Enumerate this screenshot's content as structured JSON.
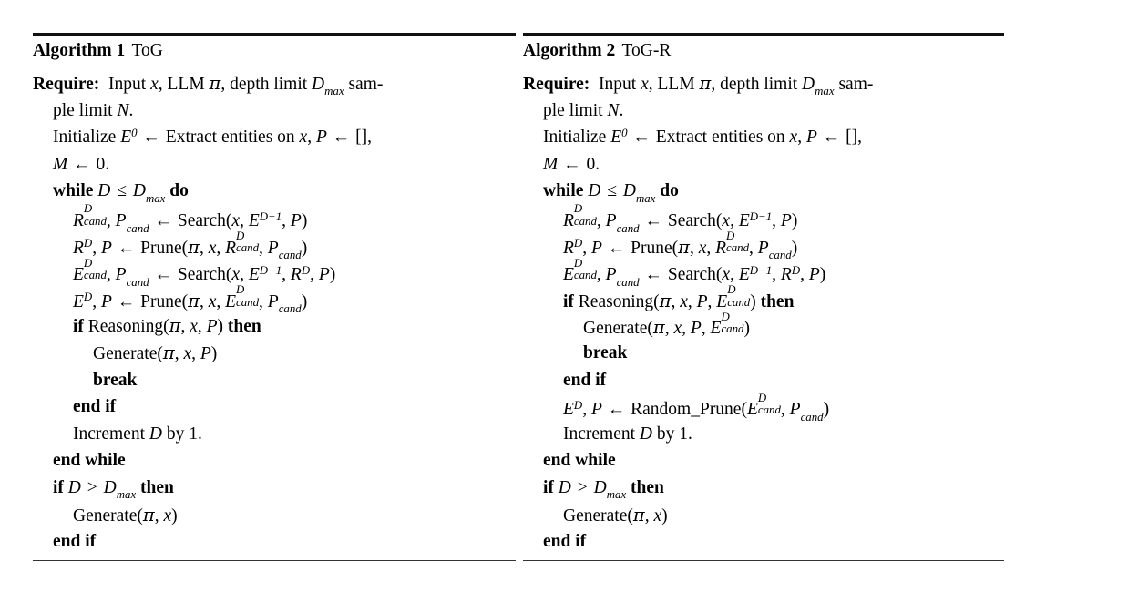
{
  "figure": {
    "kind": "algorithm-float-pair",
    "background_color": "#ffffff",
    "text_color": "#000000",
    "rule_color": "#111111"
  },
  "algorithms": [
    {
      "id": "algorithm-1",
      "label": "Algorithm 1",
      "name": "ToG",
      "lines": [
        {
          "id": "require",
          "indent": 0,
          "text": "Require:  Input x, LLM π, depth limit D_max sam-"
        },
        {
          "id": "require-cont",
          "indent": 1,
          "text": "ple limit N."
        },
        {
          "id": "initialize",
          "indent": 1,
          "text": "Initialize E^0 ← Extract entities on x, P ← [],"
        },
        {
          "id": "init-m",
          "indent": 1,
          "text": "M ← 0."
        },
        {
          "id": "while",
          "indent": 1,
          "text": "while D ≤ D_max do"
        },
        {
          "id": "search-rel",
          "indent": 2,
          "text": "R^D_cand, P_cand ← Search(x, E^{D-1}, P)"
        },
        {
          "id": "prune-rel",
          "indent": 2,
          "text": "R^D, P ← Prune(π, x, R^D_cand, P_cand)"
        },
        {
          "id": "search-ent",
          "indent": 2,
          "text": "E^D_cand, P_cand ← Search(x, E^{D-1}, R^D, P)"
        },
        {
          "id": "prune-ent",
          "indent": 2,
          "text": "E^D, P ← Prune(π, x, E^D_cand, P_cand)"
        },
        {
          "id": "if-reasoning",
          "indent": 2,
          "text": "if Reasoning(π, x, P) then"
        },
        {
          "id": "generate",
          "indent": 3,
          "text": "Generate(π, x, P)"
        },
        {
          "id": "break",
          "indent": 3,
          "text": "break"
        },
        {
          "id": "end-if-inner",
          "indent": 2,
          "text": "end if"
        },
        {
          "id": "increment",
          "indent": 2,
          "text": "Increment D by 1."
        },
        {
          "id": "end-while",
          "indent": 1,
          "text": "end while"
        },
        {
          "id": "if-depth",
          "indent": 1,
          "text": "if D > D_max then"
        },
        {
          "id": "generate-final",
          "indent": 2,
          "text": "Generate(π, x)"
        },
        {
          "id": "end-if-outer",
          "indent": 1,
          "text": "end if"
        }
      ]
    },
    {
      "id": "algorithm-2",
      "label": "Algorithm 2",
      "name": "ToG-R",
      "lines": [
        {
          "id": "require",
          "indent": 0,
          "text": "Require:  Input x, LLM π, depth limit D_max sam-"
        },
        {
          "id": "require-cont",
          "indent": 1,
          "text": "ple limit N."
        },
        {
          "id": "initialize",
          "indent": 1,
          "text": "Initialize E^0 ← Extract entities on x, P ← [],"
        },
        {
          "id": "init-m",
          "indent": 1,
          "text": "M ← 0."
        },
        {
          "id": "while",
          "indent": 1,
          "text": "while D ≤ D_max do"
        },
        {
          "id": "search-rel",
          "indent": 2,
          "text": "R^D_cand, P_cand ← Search(x, E^{D-1}, P)"
        },
        {
          "id": "prune-rel",
          "indent": 2,
          "text": "R^D, P ← Prune(π, x, R^D_cand, P_cand)"
        },
        {
          "id": "search-ent",
          "indent": 2,
          "text": "E^D_cand, P_cand ← Search(x, E^{D-1}, R^D, P)"
        },
        {
          "id": "if-reasoning",
          "indent": 2,
          "text": "if Reasoning(π, x, P, E^D_cand) then"
        },
        {
          "id": "generate",
          "indent": 3,
          "text": "Generate(π, x, P, E^D_cand)"
        },
        {
          "id": "break",
          "indent": 3,
          "text": "break"
        },
        {
          "id": "end-if-inner",
          "indent": 2,
          "text": "end if"
        },
        {
          "id": "random-prune",
          "indent": 2,
          "text": "E^D, P ← Random_Prune(E^D_cand, P_cand)"
        },
        {
          "id": "increment",
          "indent": 2,
          "text": "Increment D by 1."
        },
        {
          "id": "end-while",
          "indent": 1,
          "text": "end while"
        },
        {
          "id": "if-depth",
          "indent": 1,
          "text": "if D > D_max then"
        },
        {
          "id": "generate-final",
          "indent": 2,
          "text": "Generate(π, x)"
        },
        {
          "id": "end-if-outer",
          "indent": 1,
          "text": "end if"
        }
      ]
    }
  ]
}
